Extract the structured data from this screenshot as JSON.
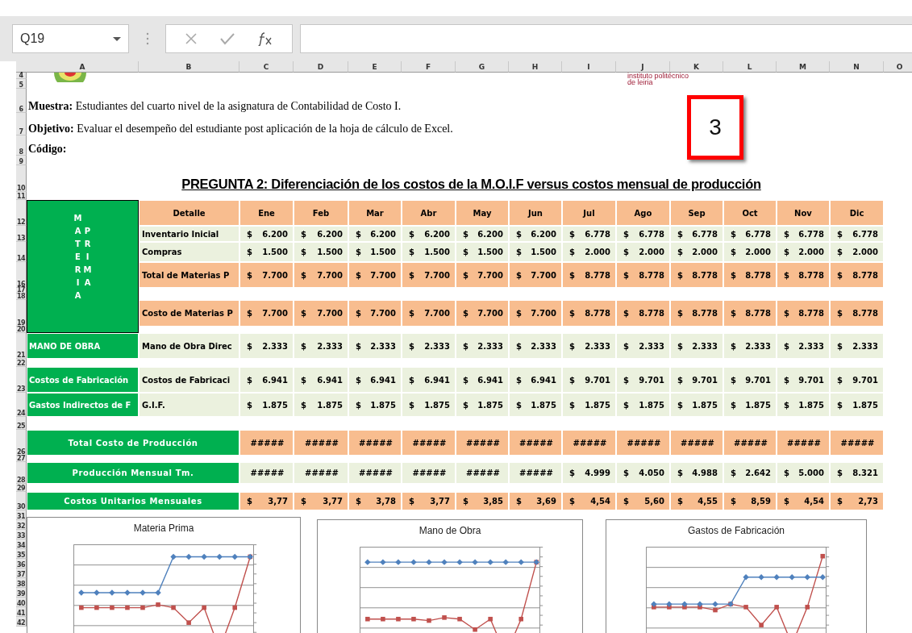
{
  "name_box": {
    "value": "Q19"
  },
  "column_headers": [
    "A",
    "B",
    "C",
    "D",
    "E",
    "F",
    "G",
    "H",
    "I",
    "J",
    "K",
    "L",
    "M",
    "N",
    "O"
  ],
  "row_headers": [
    "4",
    "5",
    "6",
    "7",
    "8",
    "9",
    "10",
    "11",
    "12",
    "13",
    "14",
    "16",
    "17",
    "18",
    "19",
    "20",
    "21",
    "22",
    "23",
    "24",
    "25",
    "26",
    "27",
    "28",
    "29",
    "30",
    "31",
    "32",
    "33",
    "34",
    "35",
    "36",
    "37",
    "38",
    "39",
    "40",
    "41",
    "42"
  ],
  "institution_text": [
    "instituto politécnico",
    "de leiria"
  ],
  "info_lines": [
    "**Muestra:** Estudiantes del cuarto nivel de la asignatura de Contabilidad de Costo I.",
    "**Objetivo:** Evaluar el desempeño del estudiante post aplicación de la hoja de cálculo de Excel.",
    "**Código:**"
  ],
  "marked_box": {
    "text": "3"
  },
  "title": "PREGUNTA 2: Diferenciación de los costos de la M.O.I.F versus costos mensual de producción",
  "table": {
    "group_label": [
      "MATERIA",
      "PRIMA"
    ],
    "detail_header": "Detalle",
    "months": [
      "Ene",
      "Feb",
      "Mar",
      "Abr",
      "May",
      "Jun",
      "Jul",
      "Ago",
      "Sep",
      "Oct",
      "Nov",
      "Dic"
    ],
    "rows": [
      {
        "label": "Inventario Inicial",
        "kind": "light",
        "values": [
          [
            "$",
            "6.200"
          ],
          [
            "$",
            "6.200"
          ],
          [
            "$",
            "6.200"
          ],
          [
            "$",
            "6.200"
          ],
          [
            "$",
            "6.200"
          ],
          [
            "$",
            "6.200"
          ],
          [
            "$",
            "6.778"
          ],
          [
            "$",
            "6.778"
          ],
          [
            "$",
            "6.778"
          ],
          [
            "$",
            "6.778"
          ],
          [
            "$",
            "6.778"
          ],
          [
            "$",
            "6.778"
          ]
        ]
      },
      {
        "label": "Compras",
        "kind": "light",
        "values": [
          [
            "$",
            "1.500"
          ],
          [
            "$",
            "1.500"
          ],
          [
            "$",
            "1.500"
          ],
          [
            "$",
            "1.500"
          ],
          [
            "$",
            "1.500"
          ],
          [
            "$",
            "1.500"
          ],
          [
            "$",
            "2.000"
          ],
          [
            "$",
            "2.000"
          ],
          [
            "$",
            "2.000"
          ],
          [
            "$",
            "2.000"
          ],
          [
            "$",
            "2.000"
          ],
          [
            "$",
            "2.000"
          ]
        ]
      },
      {
        "label": "Total de Materias P",
        "kind": "accent",
        "values": [
          [
            "$",
            "7.700"
          ],
          [
            "$",
            "7.700"
          ],
          [
            "$",
            "7.700"
          ],
          [
            "$",
            "7.700"
          ],
          [
            "$",
            "7.700"
          ],
          [
            "$",
            "7.700"
          ],
          [
            "$",
            "8.778"
          ],
          [
            "$",
            "8.778"
          ],
          [
            "$",
            "8.778"
          ],
          [
            "$",
            "8.778"
          ],
          [
            "$",
            "8.778"
          ],
          [
            "$",
            "8.778"
          ]
        ]
      },
      {
        "label": "Costo de Materias P",
        "kind": "accent",
        "values": [
          [
            "$",
            "7.700"
          ],
          [
            "$",
            "7.700"
          ],
          [
            "$",
            "7.700"
          ],
          [
            "$",
            "7.700"
          ],
          [
            "$",
            "7.700"
          ],
          [
            "$",
            "7.700"
          ],
          [
            "$",
            "8.778"
          ],
          [
            "$",
            "8.778"
          ],
          [
            "$",
            "8.778"
          ],
          [
            "$",
            "8.778"
          ],
          [
            "$",
            "8.778"
          ],
          [
            "$",
            "8.778"
          ]
        ]
      },
      {
        "group": "MANO DE OBRA",
        "label": "Mano de Obra Direc",
        "kind": "light",
        "values": [
          [
            "$",
            "2.333"
          ],
          [
            "$",
            "2.333"
          ],
          [
            "$",
            "2.333"
          ],
          [
            "$",
            "2.333"
          ],
          [
            "$",
            "2.333"
          ],
          [
            "$",
            "2.333"
          ],
          [
            "$",
            "2.333"
          ],
          [
            "$",
            "2.333"
          ],
          [
            "$",
            "2.333"
          ],
          [
            "$",
            "2.333"
          ],
          [
            "$",
            "2.333"
          ],
          [
            "$",
            "2.333"
          ]
        ]
      },
      {
        "group": "Costos de Fabricación",
        "label": "Costos de Fabricaci",
        "kind": "light",
        "values": [
          [
            "$",
            "6.941"
          ],
          [
            "$",
            "6.941"
          ],
          [
            "$",
            "6.941"
          ],
          [
            "$",
            "6.941"
          ],
          [
            "$",
            "6.941"
          ],
          [
            "$",
            "6.941"
          ],
          [
            "$",
            "9.701"
          ],
          [
            "$",
            "9.701"
          ],
          [
            "$",
            "9.701"
          ],
          [
            "$",
            "9.701"
          ],
          [
            "$",
            "9.701"
          ],
          [
            "$",
            "9.701"
          ]
        ]
      },
      {
        "group": "Gastos Indirectos de F",
        "label": "G.I.F.",
        "kind": "light",
        "values": [
          [
            "$",
            "1.875"
          ],
          [
            "$",
            "1.875"
          ],
          [
            "$",
            "1.875"
          ],
          [
            "$",
            "1.875"
          ],
          [
            "$",
            "1.875"
          ],
          [
            "$",
            "1.875"
          ],
          [
            "$",
            "1.875"
          ],
          [
            "$",
            "1.875"
          ],
          [
            "$",
            "1.875"
          ],
          [
            "$",
            "1.875"
          ],
          [
            "$",
            "1.875"
          ],
          [
            "$",
            "1.875"
          ]
        ]
      }
    ],
    "summary_rows": [
      {
        "label": "Total Costo de Producción",
        "kind": "accent",
        "values": [
          [
            "#####"
          ],
          [
            "#####"
          ],
          [
            "#####"
          ],
          [
            "#####"
          ],
          [
            "#####"
          ],
          [
            "#####"
          ],
          [
            "#####"
          ],
          [
            "#####"
          ],
          [
            "#####"
          ],
          [
            "#####"
          ],
          [
            "#####"
          ],
          [
            "#####"
          ]
        ]
      },
      {
        "label": "Producción Mensual Tm.",
        "kind": "light",
        "values": [
          [
            "#####"
          ],
          [
            "#####"
          ],
          [
            "#####"
          ],
          [
            "#####"
          ],
          [
            "#####"
          ],
          [
            "#####"
          ],
          [
            "$",
            "4.999"
          ],
          [
            "$",
            "4.050"
          ],
          [
            "$",
            "4.988"
          ],
          [
            "$",
            "2.642"
          ],
          [
            "$",
            "5.000"
          ],
          [
            "$",
            "8.321"
          ]
        ]
      },
      {
        "label": "Costos Unitarios Mensuales",
        "kind": "accent",
        "values": [
          [
            "$",
            "3,77"
          ],
          [
            "$",
            "3,77"
          ],
          [
            "$",
            "3,78"
          ],
          [
            "$",
            "3,77"
          ],
          [
            "$",
            "3,85"
          ],
          [
            "$",
            "3,69"
          ],
          [
            "$",
            "4,54"
          ],
          [
            "$",
            "5,60"
          ],
          [
            "$",
            "4,55"
          ],
          [
            "$",
            "8,59"
          ],
          [
            "$",
            "4,54"
          ],
          [
            "$",
            "2,73"
          ]
        ]
      }
    ]
  },
  "charts": [
    {
      "title": "Materia Prima"
    },
    {
      "title": "Mano de Obra"
    },
    {
      "title": "Gastos de Fabricación"
    }
  ]
}
